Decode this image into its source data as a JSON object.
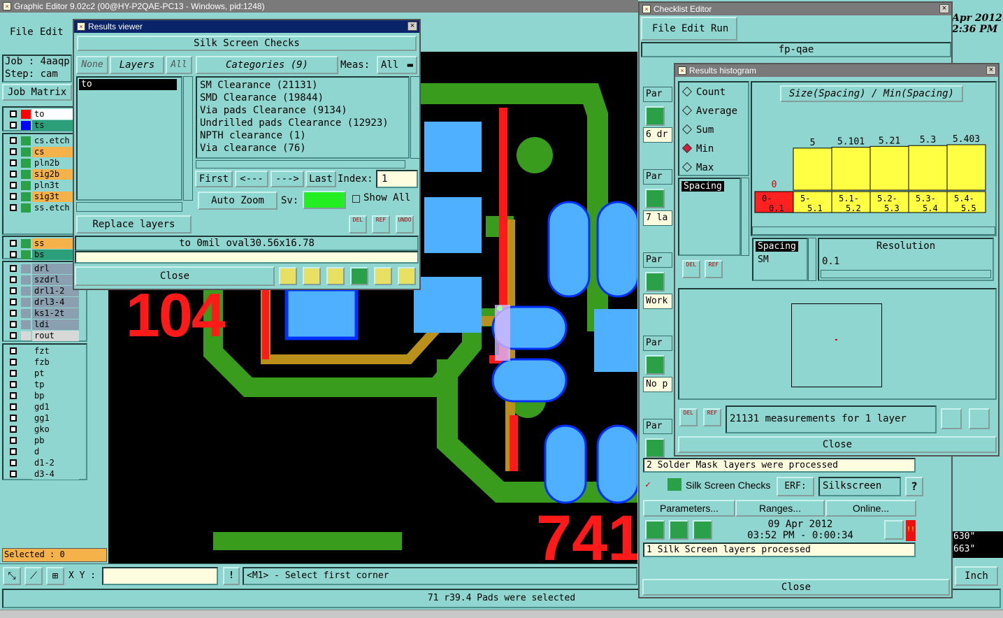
{
  "main": {
    "title": "Graphic Editor 9.02c2 (00@HY-P2QAE-PC13 - Windows, pid:1248)",
    "menu": [
      "File",
      "Edit"
    ],
    "job_label": "Job : 4aaqp",
    "step_label": "Step: cam",
    "job_matrix": "Job Matrix",
    "layers_a": [
      {
        "name": "to",
        "color": "#ff0000",
        "bg": "#ffffff"
      },
      {
        "name": "ts",
        "color": "#0000ff",
        "bg": "#2a9f7a"
      }
    ],
    "layers_b": [
      {
        "name": "cs.etch",
        "color": "#2aa048",
        "bg": "#8fd6d0"
      },
      {
        "name": "cs",
        "color": "#2aa048",
        "bg": "#f5b14a"
      },
      {
        "name": "pln2b",
        "color": "#2aa048",
        "bg": "#8fd6d0"
      },
      {
        "name": "sig2b",
        "color": "#2aa048",
        "bg": "#f5b14a"
      },
      {
        "name": "pln3t",
        "color": "#2aa048",
        "bg": "#8fd6d0"
      },
      {
        "name": "sig3t",
        "color": "#2aa048",
        "bg": "#f5b14a"
      },
      {
        "name": "ss.etch",
        "color": "#2aa048",
        "bg": "#8fd6d0"
      }
    ],
    "layers_c": [
      {
        "name": "ss",
        "color": "#2aa048",
        "bg": "#f5b14a"
      },
      {
        "name": "bs",
        "color": "#2aa048",
        "bg": "#2a9f7a"
      }
    ],
    "layers_d": [
      {
        "name": "drl",
        "color": "#8a9fb0",
        "bg": "#8a9fb0"
      },
      {
        "name": "szdrl",
        "color": "#8a9fb0",
        "bg": "#8a9fb0"
      },
      {
        "name": "drl1-2",
        "color": "#8a9fb0",
        "bg": "#8a9fb0"
      },
      {
        "name": "drl3-4",
        "color": "#8a9fb0",
        "bg": "#8a9fb0"
      },
      {
        "name": "ks1-2t",
        "color": "#8a9fb0",
        "bg": "#8a9fb0"
      },
      {
        "name": "ldi",
        "color": "#8a9fb0",
        "bg": "#8a9fb0"
      },
      {
        "name": "rout",
        "color": "#d8d8d8",
        "bg": "#d8d8d8"
      }
    ],
    "layers_e": [
      "fzt",
      "fzb",
      "pt",
      "tp",
      "bp",
      "gd1",
      "gg1",
      "gko",
      "pb",
      "d",
      "d1-2",
      "d3-4"
    ],
    "selected": "Selected : 0",
    "xy_label": "X Y :",
    "prompt": "<M1> - Select first corner",
    "status": "71 r39.4 Pads were selected",
    "date_partial": "Apr 2012",
    "time_partial": "2:36 PM",
    "unit": "Inch",
    "coord1": "630\"",
    "coord2": "663\"",
    "canvas_label1": "104",
    "canvas_label2": "741"
  },
  "results_viewer": {
    "title": "Results viewer",
    "header": "Silk Screen Checks",
    "none_btn": "None",
    "layers_btn": "Layers",
    "all_btn": "All",
    "categories_btn": "Categories (9)",
    "meas_label": "Meas:",
    "meas_value": "All",
    "layer_list": [
      "to"
    ],
    "categories": [
      "SM Clearance (21131)",
      "SMD Clearance (19844)",
      "Via pads Clearance (9134)",
      "Undrilled pads Clearance (12923)",
      "NPTH clearance (1)",
      "Via clearance (76)"
    ],
    "first_btn": "First",
    "prev_btn": "<---",
    "next_btn": "--->",
    "last_btn": "Last",
    "index_label": "Index:",
    "index_value": "1",
    "auto_zoom": "Auto Zoom",
    "sv_label": "Sv:",
    "show_all": "Show All",
    "replace_layers": "Replace layers",
    "del_icon": "DEL",
    "ref_icon": "REF",
    "undo_icon": "UNDO",
    "result_line": "to 0mil oval30.56x16.78",
    "close": "Close"
  },
  "checklist": {
    "title": "Checklist Editor",
    "menu": [
      "File",
      "Edit",
      "Run"
    ],
    "name": "fp-qae",
    "row_labels": [
      "Par",
      "6 dr",
      "Par",
      "7 la",
      "Par",
      "Work",
      "Par",
      "No p",
      "Par"
    ],
    "solder_msg": "2 Solder Mask layers were processed",
    "silk_title": "Silk Screen Checks",
    "erf_label": "ERF:",
    "erf_value": "Silkscreen",
    "help": "?",
    "parameters": "Parameters...",
    "ranges": "Ranges...",
    "online": "Online...",
    "date": "09 Apr 2012",
    "time": "03:52 PM - 0:00:34",
    "silk_msg": "1 Silk Screen layers processed",
    "close": "Close"
  },
  "histogram": {
    "title": "Results histogram",
    "modes": [
      "Count",
      "Average",
      "Sum",
      "Min",
      "Max"
    ],
    "selected_mode": "Min",
    "chart_title": "Size(Spacing) / Min(Spacing)",
    "list_item": "Spacing",
    "list2_item1": "Spacing",
    "list2_item2": "SM",
    "resolution_label": "Resolution",
    "resolution_value": "0.1",
    "measure_text": "21131 measurements for 1 layer",
    "del_icon": "DEL",
    "ref_icon": "REF",
    "close": "Close"
  },
  "chart_data": {
    "type": "bar",
    "title": "Size(Spacing) / Min(Spacing)",
    "categories": [
      "0-0.1",
      "5-5.1",
      "5.1-5.2",
      "5.2-5.3",
      "5.3-5.4",
      "5.4-5.5"
    ],
    "values": [
      0,
      5,
      5.101,
      5.21,
      5.3,
      5.403
    ],
    "value_labels": [
      "0",
      "5",
      "5.101",
      "5.21",
      "5.3",
      "5.403"
    ],
    "bar_color": "#ffff44",
    "highlight_category": "0-0.1",
    "highlight_color": "#ff2020"
  }
}
